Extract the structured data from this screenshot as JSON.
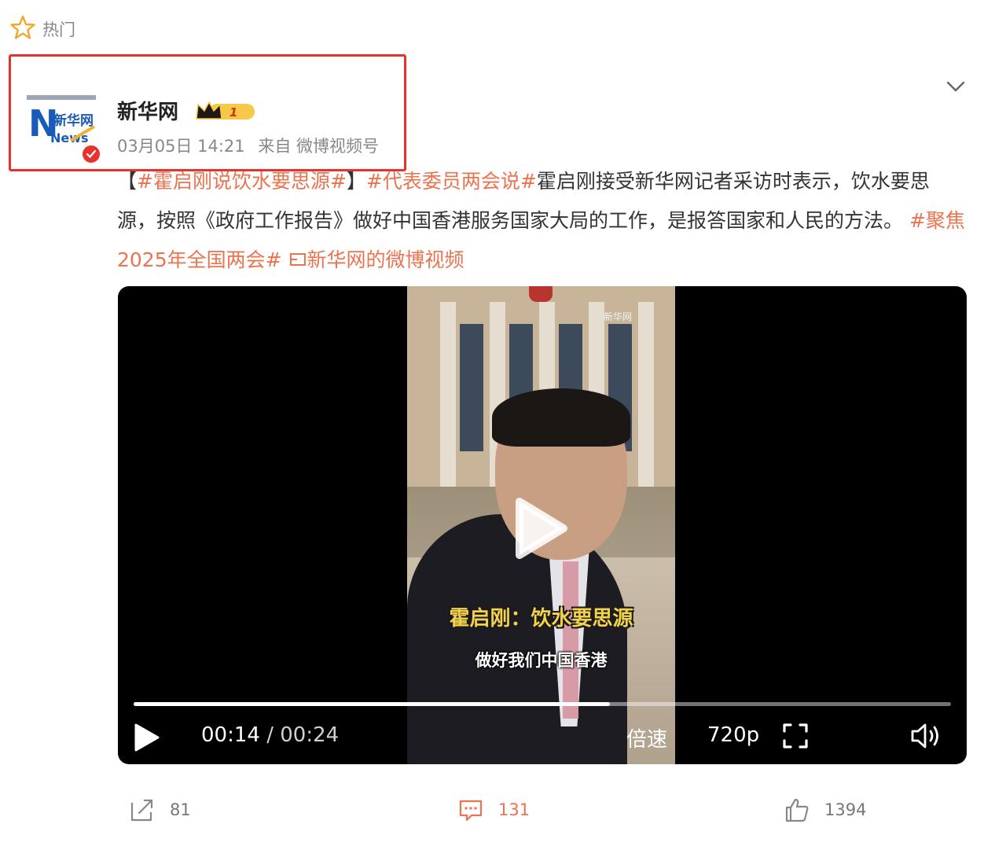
{
  "section": {
    "label": "热门"
  },
  "post": {
    "author": "新华网",
    "timestamp": "03月05日 14:21",
    "source": "来自 微博视频号",
    "avatar_text": "新华网",
    "avatar_news": "News",
    "vip_level": "1",
    "text": {
      "bracket_open": "【",
      "tag1": "#霍启刚说饮水要思源#",
      "bracket_close": "】",
      "tag2": "#代表委员两会说#",
      "body": "霍启刚接受新华网记者采访时表示，饮水要思源，按照《政府工作报告》做好中国香港服务国家大局的工作，是报答国家和人民的方法。",
      "tag3": "#聚焦2025年全国两会#",
      "link": "新华网的微博视频"
    }
  },
  "video": {
    "subtitle_name": "霍启刚：饮水要思源",
    "subtitle_line": "做好我们中国香港",
    "watermark": "新华网",
    "current_time": "00:14",
    "separator": " / ",
    "total_time": "00:24",
    "progress": 0.583,
    "speed_label": "倍速",
    "quality_label": "720p"
  },
  "actions": {
    "share_count": "81",
    "comment_count": "131",
    "like_count": "1394"
  },
  "colors": {
    "accent": "#eb7350",
    "highlight_border": "#e8322d",
    "verified": "#e8322d"
  }
}
